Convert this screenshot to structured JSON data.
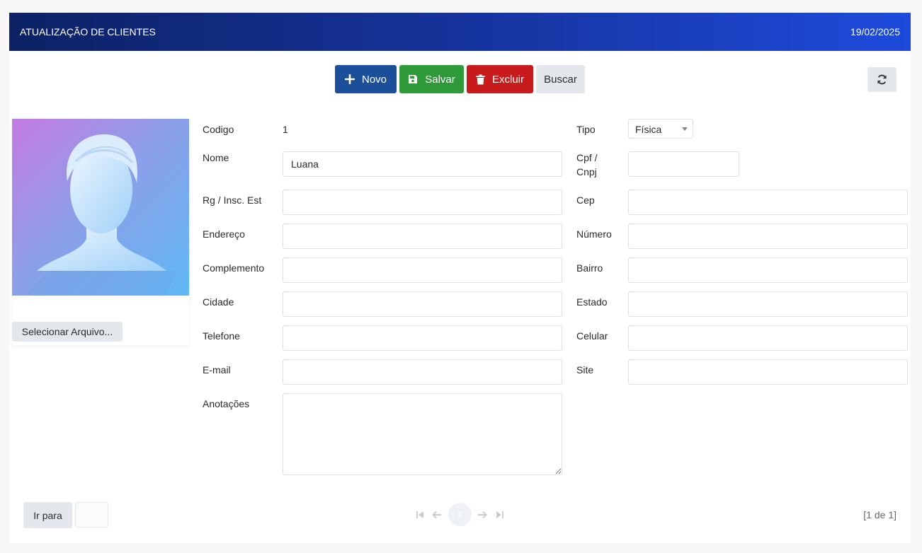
{
  "header": {
    "title": "ATUALIZAÇÃO DE CLIENTES",
    "date": "19/02/2025"
  },
  "toolbar": {
    "novo": {
      "label": "Novo",
      "icon": "plus-icon",
      "color": "#1c4f99"
    },
    "salvar": {
      "label": "Salvar",
      "icon": "floppy-disk-icon",
      "color": "#2f9a39"
    },
    "excluir": {
      "label": "Excluir",
      "icon": "trash-icon",
      "color": "#c81b1b"
    },
    "buscar": {
      "label": "Buscar"
    },
    "refresh": {
      "icon": "refresh-icon"
    }
  },
  "photo": {
    "icon": "person-silhouette-icon",
    "file_button": "Selecionar Arquivo..."
  },
  "form": {
    "codigo": {
      "label": "Codigo",
      "value": "1"
    },
    "tipo": {
      "label": "Tipo",
      "value": "Física"
    },
    "nome": {
      "label": "Nome",
      "value": "Luana"
    },
    "cpf": {
      "label": "Cpf / Cnpj",
      "value": ""
    },
    "rg": {
      "label": "Rg / Insc. Est",
      "value": ""
    },
    "cep": {
      "label": "Cep",
      "value": ""
    },
    "endereco": {
      "label": "Endereço",
      "value": ""
    },
    "numero": {
      "label": "Número",
      "value": ""
    },
    "complemento": {
      "label": "Complemento",
      "value": ""
    },
    "bairro": {
      "label": "Bairro",
      "value": ""
    },
    "cidade": {
      "label": "Cidade",
      "value": ""
    },
    "estado": {
      "label": "Estado",
      "value": ""
    },
    "telefone": {
      "label": "Telefone",
      "value": ""
    },
    "celular": {
      "label": "Celular",
      "value": ""
    },
    "email": {
      "label": "E-mail",
      "value": ""
    },
    "site": {
      "label": "Site",
      "value": ""
    },
    "anotacoes": {
      "label": "Anotações",
      "value": ""
    }
  },
  "footer": {
    "goto_label": "Ir para",
    "goto_value": "",
    "current_page": "1",
    "page_info": "[1 de 1]",
    "icons": [
      "first-page-icon",
      "prev-page-icon",
      "next-page-icon",
      "last-page-icon"
    ]
  }
}
